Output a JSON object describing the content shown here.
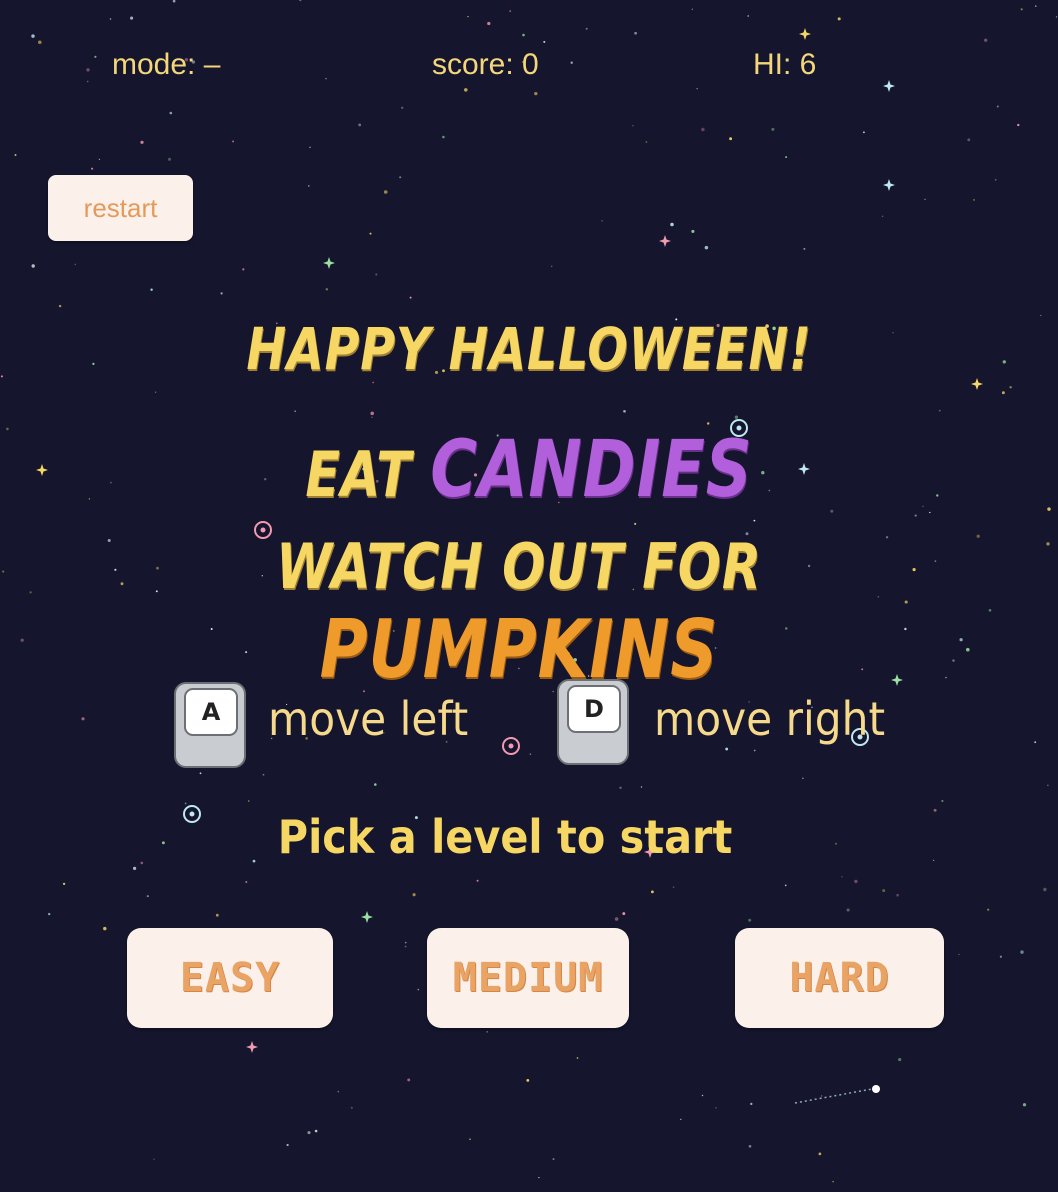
{
  "hud": {
    "mode": "mode: –",
    "score": "score: 0",
    "hi": "HI: 6"
  },
  "restart_label": "restart",
  "title": {
    "line1": "HAPPY HALLOWEEN!",
    "line2_prefix": "EAT",
    "line2_highlight": "CANDIES",
    "line3_prefix": "WATCH OUT FOR",
    "line3_highlight": "PUMPKINS"
  },
  "controls": [
    {
      "key": "A",
      "label": "move left"
    },
    {
      "key": "D",
      "label": "move right"
    }
  ],
  "prompt": "Pick a level to start",
  "levels": [
    "EASY",
    "MEDIUM",
    "HARD"
  ],
  "colors": {
    "background": "#15162e",
    "accent_yellow": "#f6d763",
    "candies_purple": "#b15fdb",
    "pumpkins_orange": "#ef9b2c",
    "button_bg": "#fcf1ea",
    "button_text": "#e8a365"
  }
}
